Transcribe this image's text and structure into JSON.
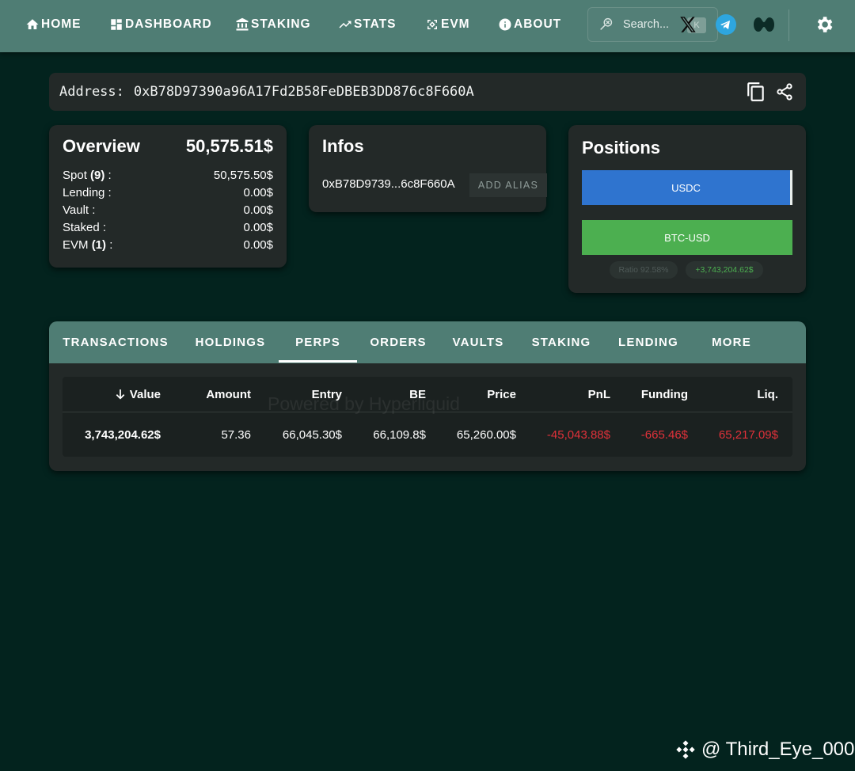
{
  "nav": {
    "items": [
      {
        "label": "HOME",
        "icon": "home-icon"
      },
      {
        "label": "DASHBOARD",
        "icon": "dashboard-icon"
      },
      {
        "label": "STAKING",
        "icon": "bank-icon"
      },
      {
        "label": "STATS",
        "icon": "trending-icon"
      },
      {
        "label": "EVM",
        "icon": "evm-icon"
      },
      {
        "label": "ABOUT",
        "icon": "info-icon"
      }
    ],
    "search_placeholder": "Search...",
    "search_shortcut": "K",
    "social_icons": [
      "x-icon",
      "telegram-icon",
      "hyperliquid-icon"
    ],
    "settings_icon": "gear-icon"
  },
  "address": {
    "label": "Address:",
    "value": "0xB78D97390a96A17Fd2B58FeDBEB3DD876c8F660A"
  },
  "overview": {
    "title": "Overview",
    "total": "50,575.51$",
    "rows": [
      {
        "label": "Spot",
        "count": "(9)",
        "suffix": " :",
        "value": "50,575.50$"
      },
      {
        "label": "Lending :",
        "count": "",
        "suffix": "",
        "value": "0.00$"
      },
      {
        "label": "Vault :",
        "count": "",
        "suffix": "",
        "value": "0.00$"
      },
      {
        "label": "Staked :",
        "count": "",
        "suffix": "",
        "value": "0.00$"
      },
      {
        "label": "EVM",
        "count": "(1)",
        "suffix": " :",
        "value": "0.00$"
      }
    ]
  },
  "infos": {
    "title": "Infos",
    "short_address": "0xB78D9739...6c8F660A",
    "add_alias_label": "ADD ALIAS"
  },
  "positions": {
    "title": "Positions",
    "bars": [
      {
        "label": "USDC",
        "color": "#2f74cf"
      },
      {
        "label": "BTC-USD",
        "color": "#4caf50"
      }
    ],
    "ratio_label": "Ratio",
    "ratio_value": "92.58%",
    "delta": "+3,743,204.62$"
  },
  "tabs": {
    "items": [
      "TRANSACTIONS",
      "HOLDINGS",
      "PERPS",
      "ORDERS",
      "VAULTS",
      "STAKING",
      "LENDING",
      "MORE"
    ],
    "active": "PERPS"
  },
  "perps_table": {
    "columns": [
      "Value",
      "Amount",
      "Entry",
      "BE",
      "Price",
      "PnL",
      "Funding",
      "Liq."
    ],
    "sort_column": "Value",
    "rows": [
      {
        "value": "3,743,204.62$",
        "amount": "57.36",
        "entry": "66,045.30$",
        "be": "66,109.8$",
        "price": "65,260.00$",
        "pnl": "-45,043.88$",
        "funding": "-665.46$",
        "liq": "65,217.09$"
      }
    ],
    "watermark": "Powered by Hyperliquid"
  },
  "credit": {
    "handle": "@ Third_Eye_000",
    "icon": "binance-icon"
  },
  "colors": {
    "background": "#03231e",
    "nav": "#4f7d74",
    "card": "#232928",
    "negative": "#e0313a",
    "positive": "#4caf50"
  }
}
